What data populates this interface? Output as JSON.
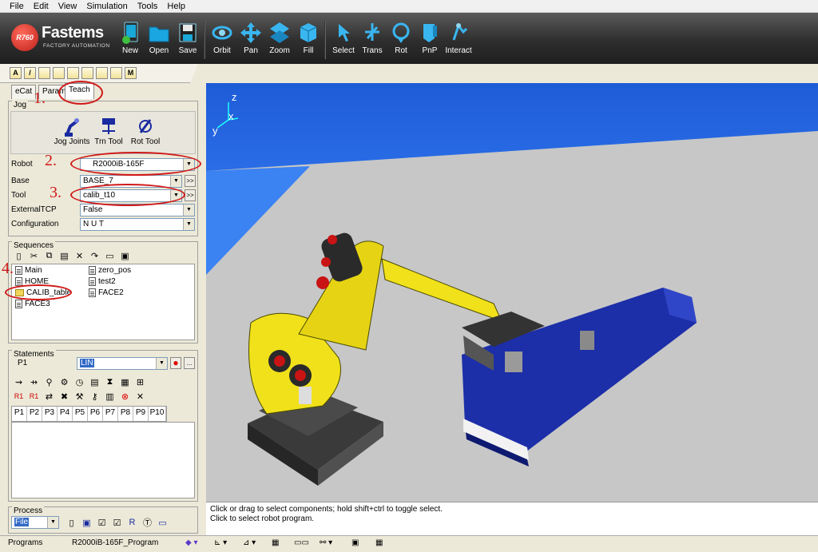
{
  "menu": [
    "File",
    "Edit",
    "View",
    "Simulation",
    "Tools",
    "Help"
  ],
  "logo": {
    "badge": "R760",
    "name": "Fastems",
    "sub": "FACTORY AUTOMATION"
  },
  "toolbar": [
    {
      "label": "New",
      "icon": "new-file-icon"
    },
    {
      "label": "Open",
      "icon": "open-folder-icon"
    },
    {
      "label": "Save",
      "icon": "save-disk-icon"
    },
    {
      "label": "Orbit",
      "icon": "orbit-icon"
    },
    {
      "label": "Pan",
      "icon": "pan-icon"
    },
    {
      "label": "Zoom",
      "icon": "zoom-icon"
    },
    {
      "label": "Fill",
      "icon": "fill-cube-icon"
    },
    {
      "label": "Select",
      "icon": "select-arrow-icon"
    },
    {
      "label": "Trans",
      "icon": "translate-icon"
    },
    {
      "label": "Rot",
      "icon": "rotate-icon"
    },
    {
      "label": "PnP",
      "icon": "pick-and-place-icon"
    },
    {
      "label": "Interact",
      "icon": "interact-icon"
    }
  ],
  "small_toolbar": [
    "A",
    "",
    "",
    "",
    "",
    "",
    "",
    "M"
  ],
  "tabs": [
    "eCat",
    "Param",
    "Teach"
  ],
  "jog": {
    "title": "Jog",
    "buttons": [
      "Jog Joints",
      "Trn Tool",
      "Rot Tool"
    ]
  },
  "fields": {
    "robot_label": "Robot",
    "robot_value": "R2000iB-165F",
    "base_label": "Base",
    "base_value": "BASE_7",
    "tool_label": "Tool",
    "tool_value": "calib_t10",
    "external_label": "ExternalTCP",
    "external_value": "False",
    "config_label": "Configuration",
    "config_value": "N U T",
    "more": ">>"
  },
  "sequences": {
    "title": "Sequences",
    "col1": [
      "Main",
      "HOME",
      "CALIB_table",
      "FACE3"
    ],
    "col2": [
      "zero_pos",
      "test2",
      "FACE2"
    ]
  },
  "statements": {
    "title": "Statements",
    "point_label": "P1",
    "motion_value": "LIN",
    "ellipsis": "...",
    "points": [
      "P1",
      "P2",
      "P3",
      "P4",
      "P5",
      "P6",
      "P7",
      "P8",
      "P9",
      "P10"
    ]
  },
  "process": {
    "title": "Process",
    "value": "File"
  },
  "viewport": {
    "axis_z": "z",
    "axis_x": "x",
    "axis_y": "y"
  },
  "status_lines": [
    "Click or drag to select components; hold shift+ctrl to toggle select.",
    "Click to select robot program."
  ],
  "bottom": {
    "left": "Programs",
    "program": "R2000iB-165F_Program"
  },
  "annotations": [
    "1.",
    "2.",
    "3.",
    "4."
  ],
  "colors": {
    "annotation": "#d01818",
    "robot": "#f0e11a",
    "sky": "#2f74ee",
    "floor": "#c7c7c7",
    "track": "#1c2ea8"
  }
}
